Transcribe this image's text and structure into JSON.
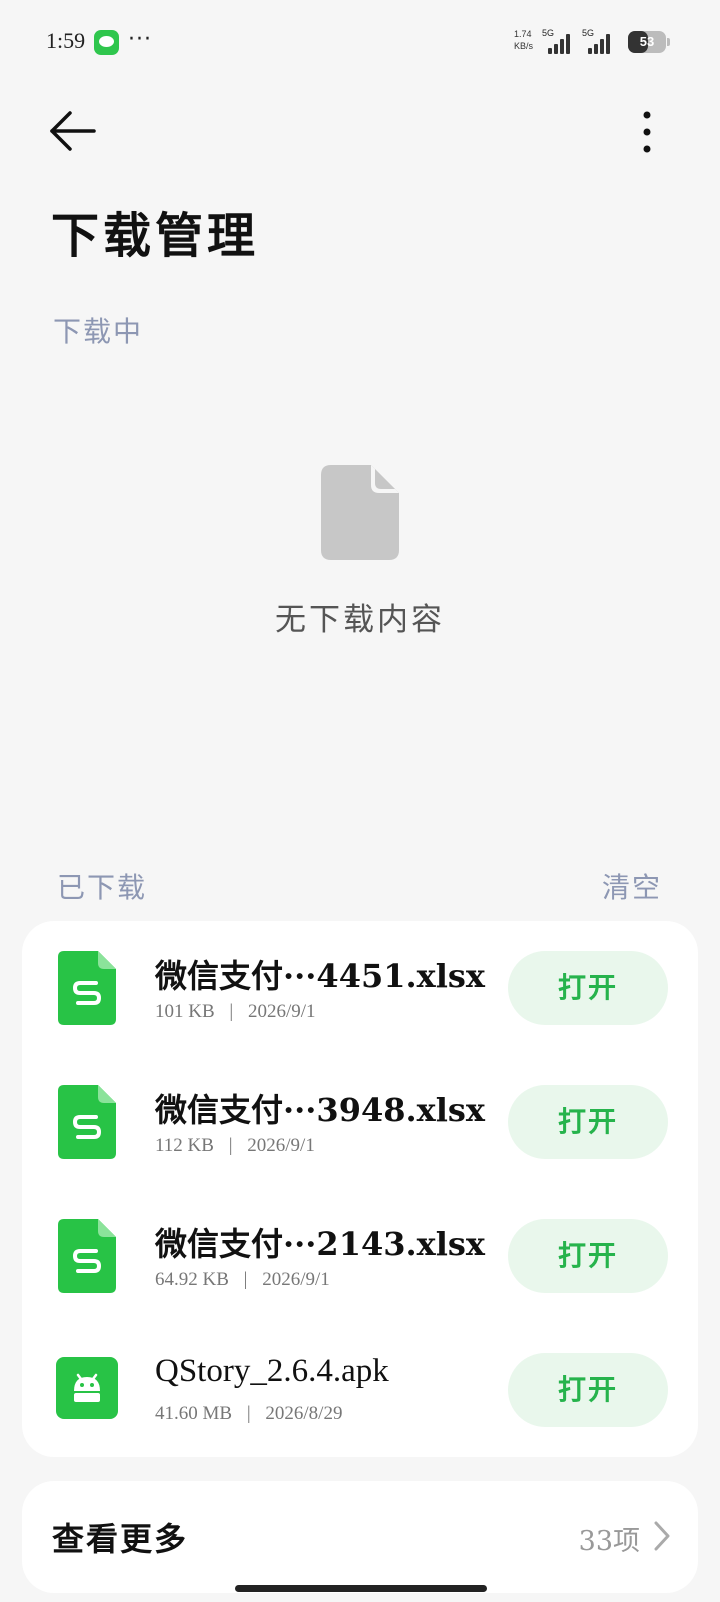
{
  "status_bar": {
    "time": "1:59",
    "more_indicator": "···",
    "net_speed_value": "1.74",
    "net_speed_unit": "KB/s",
    "signal_1_label": "5G",
    "signal_2_label": "5G",
    "battery_level": "53"
  },
  "header": {
    "back_icon": "arrow-left-icon",
    "more_icon": "vertical-ellipsis-icon",
    "title": "下载管理"
  },
  "downloading": {
    "section_label": "下载中",
    "empty_icon": "file-icon",
    "empty_text": "无下载内容"
  },
  "downloaded": {
    "section_label": "已下载",
    "clear_label": "清空",
    "files": [
      {
        "name": "微信支付···4451.xlsx",
        "size": "101 KB",
        "date": "2026/9/1",
        "icon": "spreadsheet-icon",
        "action": "打开"
      },
      {
        "name": "微信支付···3948.xlsx",
        "size": "112 KB",
        "date": "2026/9/1",
        "icon": "spreadsheet-icon",
        "action": "打开"
      },
      {
        "name": "微信支付···2143.xlsx",
        "size": "64.92 KB",
        "date": "2026/9/1",
        "icon": "spreadsheet-icon",
        "action": "打开"
      },
      {
        "name": "QStory_2.6.4.apk",
        "size": "41.60 MB",
        "date": "2026/8/29",
        "icon": "android-apk-icon",
        "action": "打开"
      }
    ],
    "separator": "|"
  },
  "view_more": {
    "label": "查看更多",
    "count": "33项"
  },
  "colors": {
    "accent_green": "#26b34c",
    "button_bg": "#e9f7ec",
    "section_label": "#8d97b3",
    "background": "#f6f6f6"
  }
}
